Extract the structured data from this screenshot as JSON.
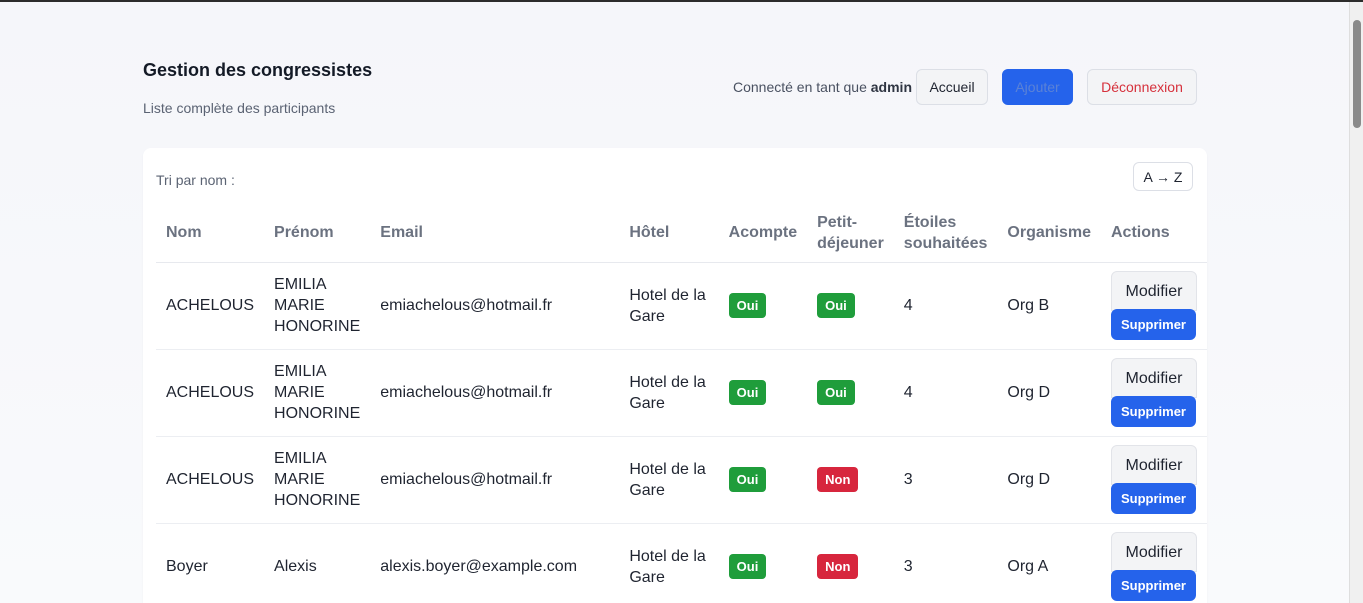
{
  "header": {
    "title": "Gestion des congressistes",
    "subtitle": "Liste complète des participants",
    "connected_prefix": "Connecté en tant que",
    "username": "admin",
    "home_label": "Accueil",
    "add_label": "Ajouter",
    "logout_label": "Déconnexion"
  },
  "sort": {
    "label": "Tri par nom :",
    "button_label": "A → Z"
  },
  "table": {
    "columns": [
      "Nom",
      "Prénom",
      "Email",
      "Hôtel",
      "Acompte",
      "Petit-déjeuner",
      "Étoiles souhaitées",
      "Organisme",
      "Actions"
    ],
    "rows": [
      {
        "nom": "ACHELOUS",
        "prenom": "EMILIA MARIE HONORINE",
        "email": "emiachelous@hotmail.fr",
        "hotel": "Hotel de la Gare",
        "acompte": "Oui",
        "petit_dejeuner": "Oui",
        "etoiles": "4",
        "organisme": "Org B"
      },
      {
        "nom": "ACHELOUS",
        "prenom": "EMILIA MARIE HONORINE",
        "email": "emiachelous@hotmail.fr",
        "hotel": "Hotel de la Gare",
        "acompte": "Oui",
        "petit_dejeuner": "Oui",
        "etoiles": "4",
        "organisme": "Org D"
      },
      {
        "nom": "ACHELOUS",
        "prenom": "EMILIA MARIE HONORINE",
        "email": "emiachelous@hotmail.fr",
        "hotel": "Hotel de la Gare",
        "acompte": "Oui",
        "petit_dejeuner": "Non",
        "etoiles": "3",
        "organisme": "Org D"
      },
      {
        "nom": "Boyer",
        "prenom": "Alexis",
        "email": "alexis.boyer@example.com",
        "hotel": "Hotel de la Gare",
        "acompte": "Oui",
        "petit_dejeuner": "Non",
        "etoiles": "3",
        "organisme": "Org A"
      }
    ],
    "edit_label": "Modifier",
    "delete_label": "Supprimer"
  },
  "colors": {
    "primary": "#2563eb",
    "success": "#1f9d3b",
    "danger": "#d7263d"
  }
}
